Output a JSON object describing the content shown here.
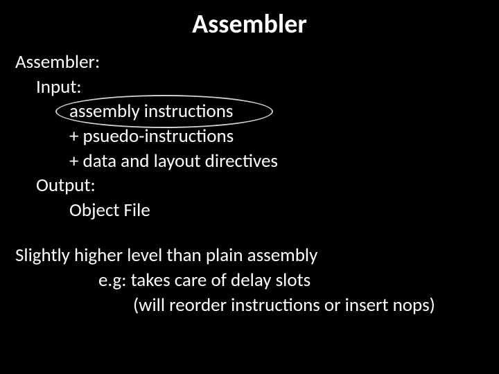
{
  "title": "Assembler",
  "heading": "Assembler:",
  "input_label": "Input:",
  "input_items": {
    "l1": "assembly instructions",
    "l2": "+ psuedo-instructions",
    "l3": "+ data and layout directives"
  },
  "output_label": "Output:",
  "output_item": "Object File",
  "note_main": "Slightly higher level than plain assembly",
  "note_sub1": "e.g: takes care of delay slots",
  "note_sub2": "(will reorder instructions or insert nops)"
}
